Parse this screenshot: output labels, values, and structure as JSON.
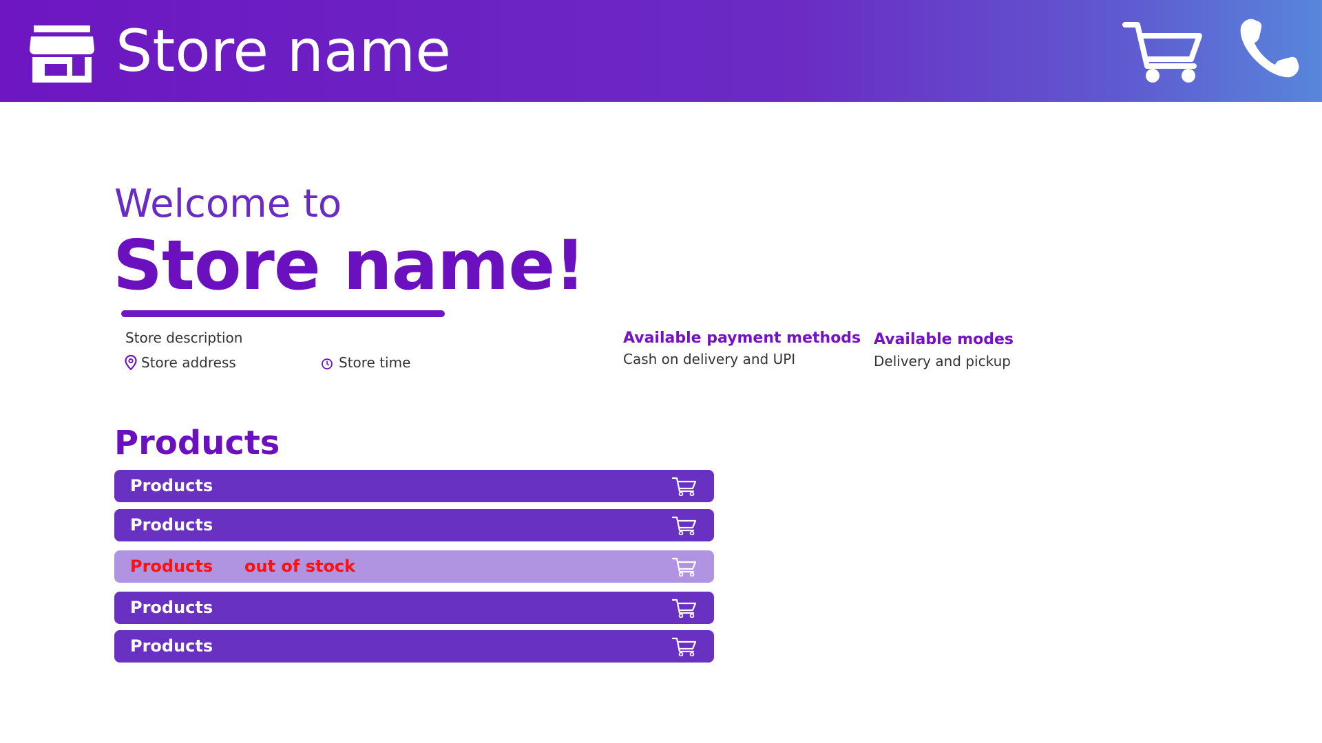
{
  "header": {
    "store_name": "Store name"
  },
  "hero": {
    "welcome": "Welcome to",
    "store_name": "Store name!"
  },
  "info": {
    "description": "Store description",
    "address": "Store address",
    "time": "Store time",
    "payment_heading": "Available payment methods",
    "payment_value": "Cash on delivery and UPI",
    "modes_heading": "Available modes",
    "modes_value": "Delivery and pickup"
  },
  "products": {
    "heading": "Products",
    "items": [
      {
        "name": "Products",
        "status": ""
      },
      {
        "name": "Products",
        "status": ""
      },
      {
        "name": "Products",
        "status": "out of stock"
      },
      {
        "name": "Products",
        "status": ""
      },
      {
        "name": "Products",
        "status": ""
      }
    ]
  },
  "colors": {
    "brand_purple": "#6d16c2",
    "row_purple": "#6931c2",
    "row_disabled": "#b093e1",
    "out_of_stock_red": "#ff0f0f"
  },
  "icons": {
    "store": "store-icon",
    "cart": "cart-icon",
    "phone": "phone-icon",
    "pin": "map-pin-icon",
    "clock": "clock-icon"
  }
}
